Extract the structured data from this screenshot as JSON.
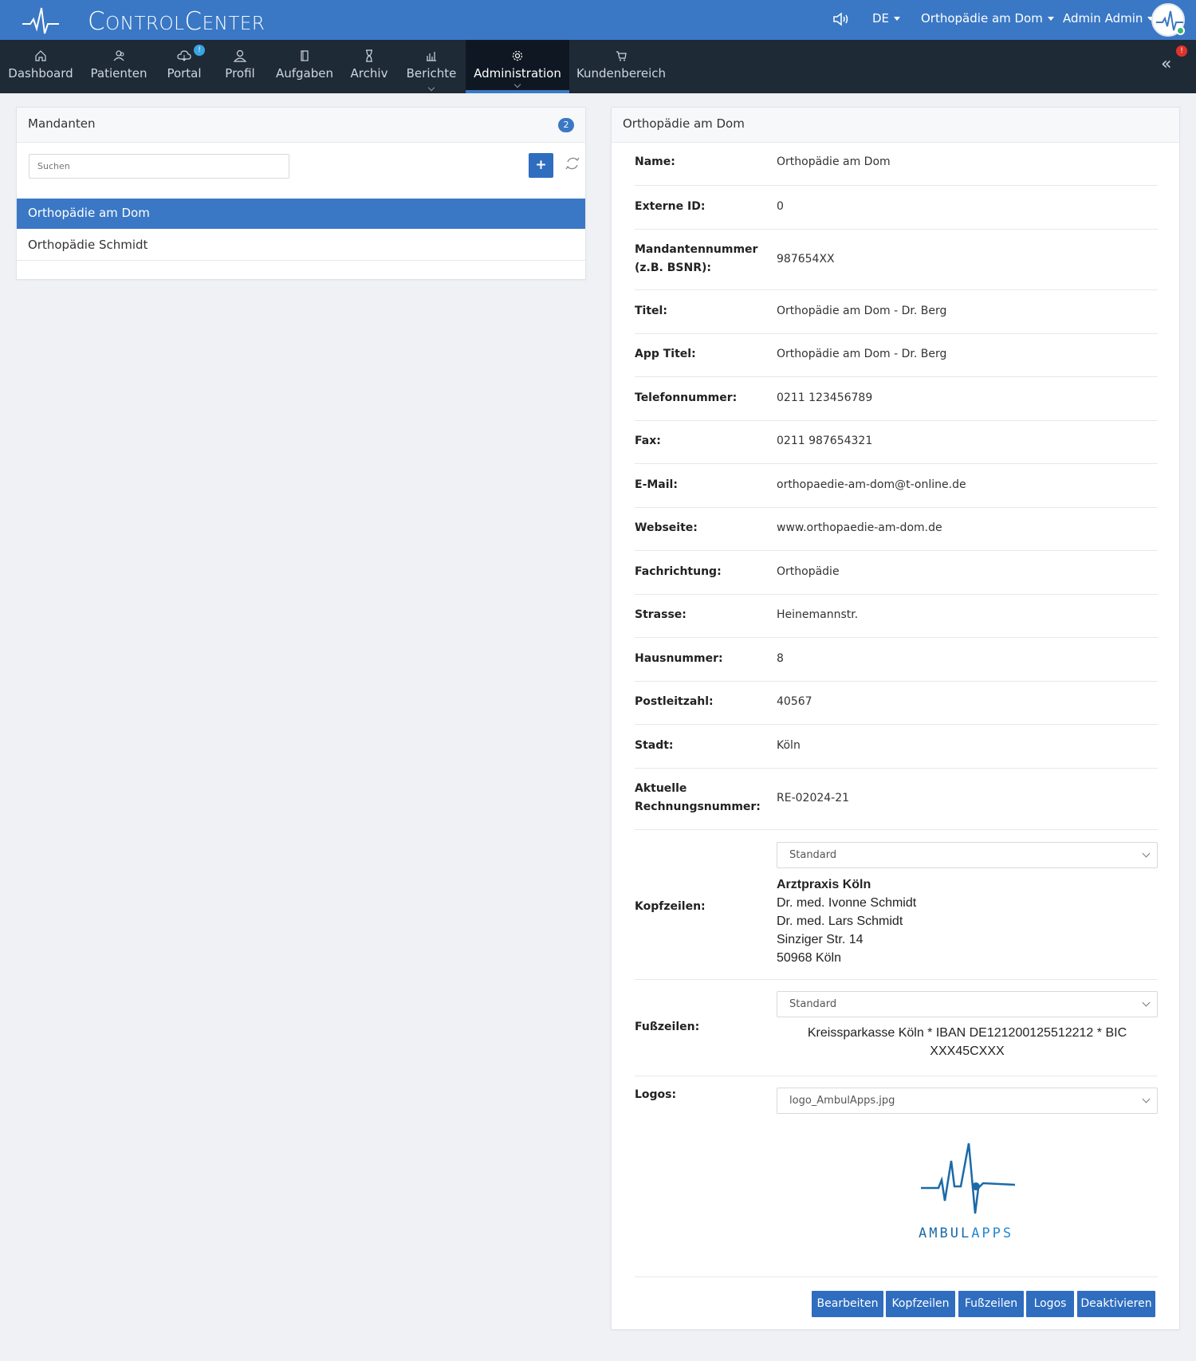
{
  "app": {
    "brand_big1": "C",
    "brand_sm1": "ONTROL",
    "brand_big2": "C",
    "brand_sm2": "ENTER",
    "language": "DE",
    "current_client": "Orthopädie am Dom",
    "user": "Admin Admin"
  },
  "nav": {
    "items": [
      {
        "label": "Dashboard",
        "icon": "home-icon"
      },
      {
        "label": "Patienten",
        "icon": "patients-icon"
      },
      {
        "label": "Portal",
        "icon": "cloud-icon",
        "badge": "!"
      },
      {
        "label": "Profil",
        "icon": "user-icon"
      },
      {
        "label": "Aufgaben",
        "icon": "clipboard-icon"
      },
      {
        "label": "Archiv",
        "icon": "hourglass-icon"
      },
      {
        "label": "Berichte",
        "icon": "bar-chart-icon"
      },
      {
        "label": "Administration",
        "icon": "gear-icon"
      },
      {
        "label": "Kundenbereich",
        "icon": "cart-icon"
      }
    ],
    "alert_badge": "!"
  },
  "clients_panel": {
    "title": "Mandanten",
    "count": "2",
    "search_placeholder": "Suchen",
    "add_label": "+",
    "items": [
      "Orthopädie am Dom",
      "Orthopädie Schmidt"
    ]
  },
  "detail": {
    "title": "Orthopädie am Dom",
    "fields": [
      {
        "label": "Name:",
        "value": "Orthopädie am Dom"
      },
      {
        "label": "Externe ID:",
        "value": "0"
      },
      {
        "label": "Mandantennummer (z.B. BSNR):",
        "value": "987654XX"
      },
      {
        "label": "Titel:",
        "value": "Orthopädie am Dom - Dr. Berg"
      },
      {
        "label": "App Titel:",
        "value": "Orthopädie am Dom - Dr. Berg"
      },
      {
        "label": "Telefonnummer:",
        "value": "0211 123456789"
      },
      {
        "label": "Fax:",
        "value": "0211 987654321"
      },
      {
        "label": "E-Mail:",
        "value": "orthopaedie-am-dom@t-online.de"
      },
      {
        "label": "Webseite:",
        "value": "www.orthopaedie-am-dom.de"
      },
      {
        "label": "Fachrichtung:",
        "value": "Orthopädie"
      },
      {
        "label": "Strasse:",
        "value": "Heinemannstr."
      },
      {
        "label": "Hausnummer:",
        "value": "8"
      },
      {
        "label": "Postleitzahl:",
        "value": "40567"
      },
      {
        "label": "Stadt:",
        "value": "Köln"
      },
      {
        "label": "Aktuelle Rechnungsnummer:",
        "value": "RE-02024-21"
      }
    ],
    "header": {
      "label": "Kopfzeilen:",
      "selected": "Standard",
      "lines": [
        "Arztpraxis Köln",
        "Dr. med. Ivonne Schmidt",
        "Dr. med. Lars Schmidt",
        "Sinziger Str. 14",
        "50968 Köln"
      ]
    },
    "footer": {
      "label": "Fußzeilen:",
      "selected": "Standard",
      "text": "Kreissparkasse Köln * IBAN DE121200125512212 * BIC XXX45CXXX"
    },
    "logos": {
      "label": "Logos:",
      "selected": "logo_AmbulApps.jpg",
      "logo_text_a": "AMBUL",
      "logo_text_b": "APPS"
    },
    "buttons": [
      "Bearbeiten",
      "Kopfzeilen",
      "Fußzeilen",
      "Logos",
      "Deaktivieren"
    ]
  },
  "colors": {
    "primary": "#3a78c5",
    "nav_bg": "#1f2a37",
    "logo_blue": "#1a6aa8"
  }
}
